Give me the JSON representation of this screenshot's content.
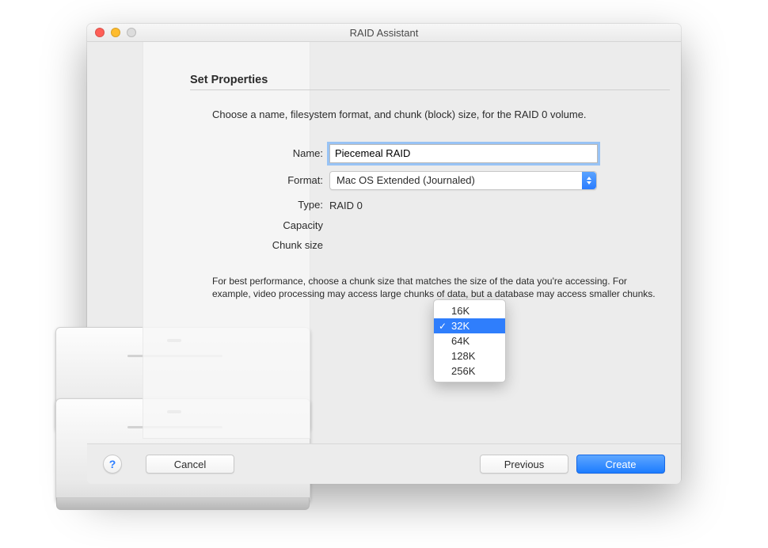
{
  "window": {
    "title": "RAID Assistant"
  },
  "panel": {
    "heading": "Set Properties",
    "intro": "Choose a name, filesystem format, and chunk (block) size, for the RAID 0 volume.",
    "hint": "For best performance, choose a chunk size that matches the size of the data you're accessing. For example, video processing may access large chunks of data, but a database may access smaller chunks."
  },
  "labels": {
    "name": "Name:",
    "format": "Format:",
    "type": "Type:",
    "capacity": "Capacity",
    "chunk": "Chunk size"
  },
  "values": {
    "name": "Piecemeal RAID",
    "format": "Mac OS Extended (Journaled)",
    "type": "RAID 0"
  },
  "chunk_options": [
    "16K",
    "32K",
    "64K",
    "128K",
    "256K"
  ],
  "chunk_selected_index": 1,
  "footer": {
    "cancel": "Cancel",
    "previous": "Previous",
    "create": "Create"
  }
}
